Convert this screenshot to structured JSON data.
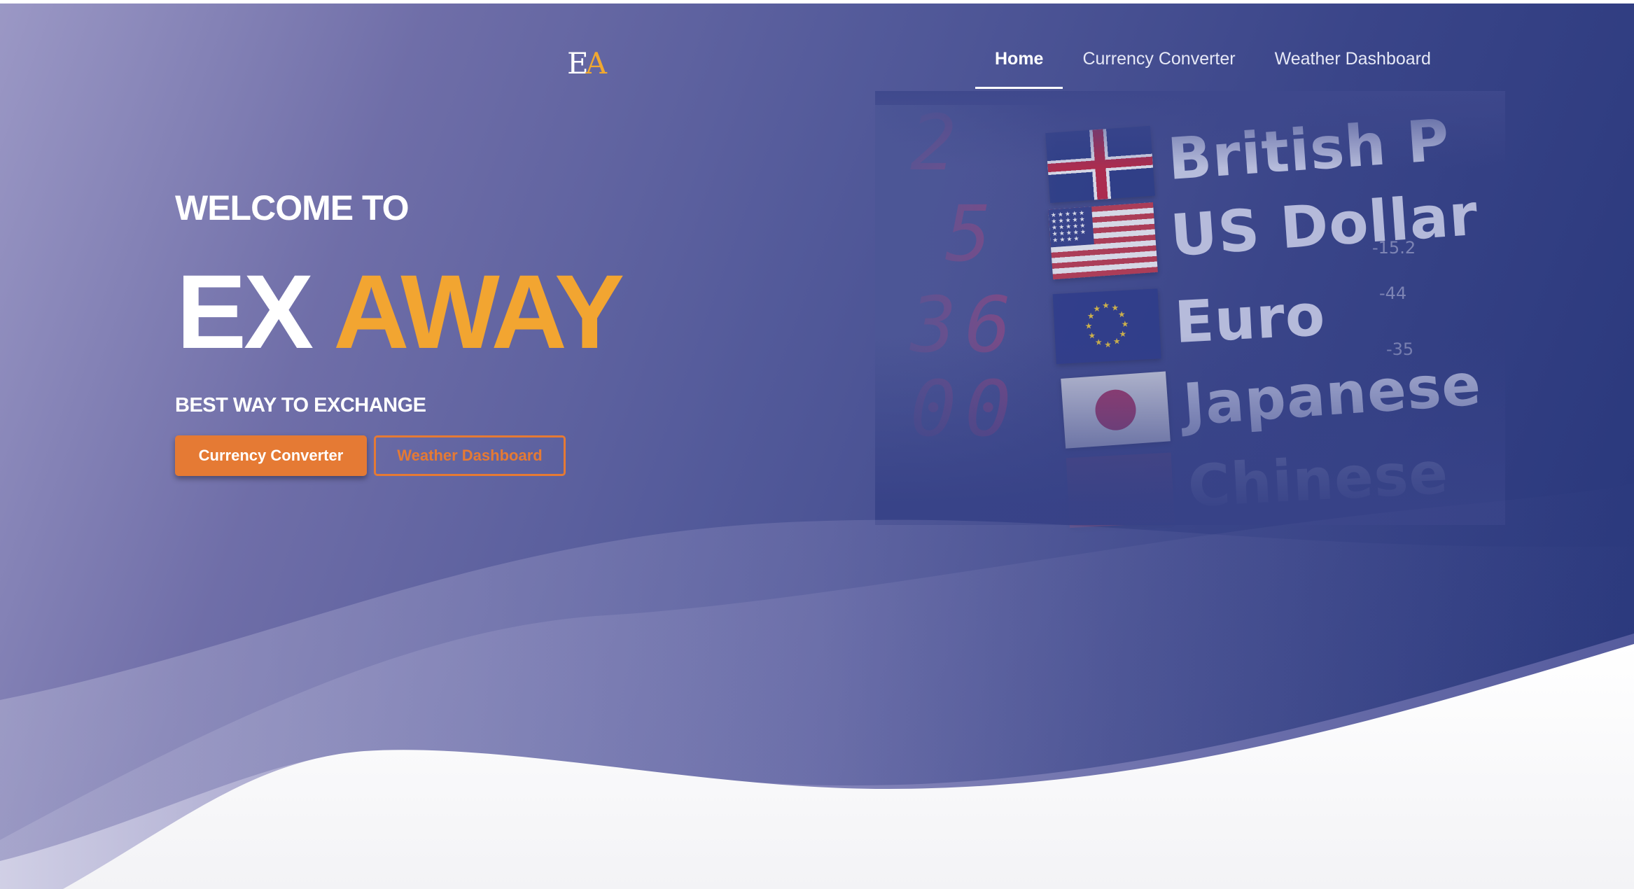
{
  "logo": {
    "letter_e": "E",
    "letter_a": "A"
  },
  "nav": {
    "items": [
      {
        "label": "Home",
        "active": true
      },
      {
        "label": "Currency Converter",
        "active": false
      },
      {
        "label": "Weather Dashboard",
        "active": false
      }
    ]
  },
  "hero": {
    "welcome": "WELCOME TO",
    "brand_first": "EX",
    "brand_second": "AWAY",
    "tagline": "BEST WAY TO EXCHANGE",
    "primary_button": "Currency Converter",
    "secondary_button": "Weather Dashboard"
  },
  "board": {
    "rows": [
      {
        "flag": "uk-flag",
        "name": "British P",
        "digit": "2"
      },
      {
        "flag": "us-flag",
        "name": "US Dollar",
        "digit": "5"
      },
      {
        "flag": "eu-flag",
        "name": "Euro",
        "digit": "36"
      },
      {
        "flag": "jp-flag",
        "name": "Japanese",
        "digit": "00"
      },
      {
        "flag": "cn-flag",
        "name": "Chinese",
        "digit": ""
      }
    ],
    "small_numbers": [
      "-15.2",
      "-44",
      "-35"
    ]
  },
  "colors": {
    "accent_orange": "#e57a34",
    "brand_gold": "#f2a531",
    "hero_dark": "#263579",
    "hero_light": "#9b98c5"
  }
}
